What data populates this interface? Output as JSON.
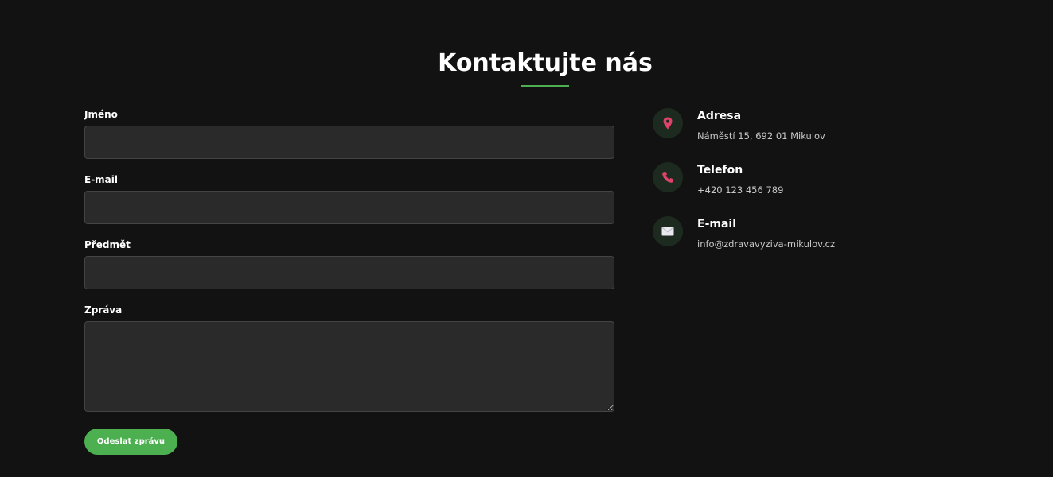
{
  "section": {
    "title": "Kontaktujte nás"
  },
  "form": {
    "name_label": "Jméno",
    "name_value": "",
    "email_label": "E-mail",
    "email_value": "",
    "subject_label": "Předmět",
    "subject_value": "",
    "message_label": "Zpráva",
    "message_value": "",
    "submit_label": "Odeslat zprávu"
  },
  "contact": {
    "items": [
      {
        "icon": "map-pin-icon",
        "title": "Adresa",
        "value": "Náměstí 15, 692 01 Mikulov"
      },
      {
        "icon": "phone-icon",
        "title": "Telefon",
        "value": "+420 123 456 789"
      },
      {
        "icon": "envelope-icon",
        "title": "E-mail",
        "value": "info@zdravavyziva-mikulov.cz"
      }
    ]
  },
  "colors": {
    "background": "#121212",
    "accent": "#4caf50",
    "input_background": "#2a2a2a",
    "icon_circle": "#1d2a1f",
    "icon_red": "#e0436a"
  }
}
